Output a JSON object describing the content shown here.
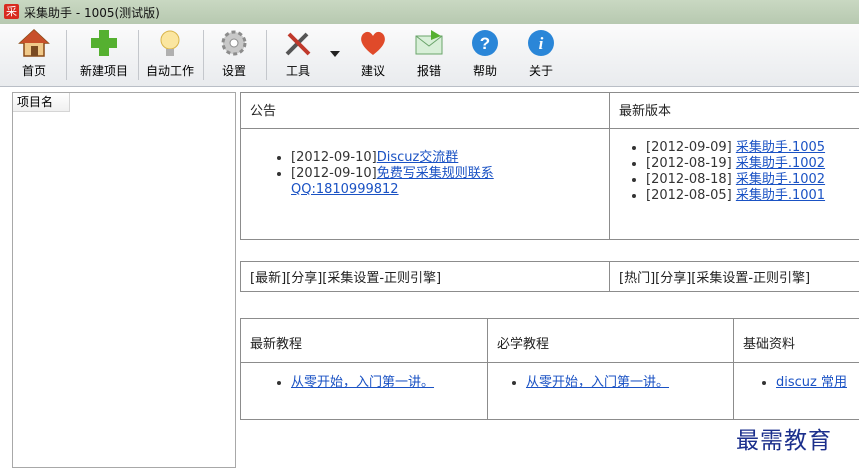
{
  "window": {
    "title": "采集助手 - 1005(测试版)",
    "app_icon_char": "采"
  },
  "toolbar": {
    "items": [
      {
        "label": "首页",
        "icon": "home-icon"
      },
      {
        "label": "新建项目",
        "icon": "plus-icon"
      },
      {
        "label": "自动工作",
        "icon": "bulb-icon"
      },
      {
        "label": "设置",
        "icon": "gear-icon"
      },
      {
        "label": "工具",
        "icon": "tools-icon"
      },
      {
        "label": "建议",
        "icon": "heart-icon"
      },
      {
        "label": "报错",
        "icon": "mail-icon"
      },
      {
        "label": "帮助",
        "icon": "help-icon"
      },
      {
        "label": "关于",
        "icon": "info-icon"
      }
    ]
  },
  "left_panel": {
    "column_header": "项目名"
  },
  "notice": {
    "header": "公告",
    "items": [
      {
        "date": "[2012-09-10]",
        "link": "Discuz交流群"
      },
      {
        "date": "[2012-09-10]",
        "link": "免费写采集规则联系QQ:1810999812"
      }
    ]
  },
  "latest_version": {
    "header": "最新版本",
    "items": [
      {
        "date": "[2012-09-09]",
        "link": "采集助手.1005"
      },
      {
        "date": "[2012-08-19]",
        "link": "采集助手.1002"
      },
      {
        "date": "[2012-08-18]",
        "link": "采集助手.1002"
      },
      {
        "date": "[2012-08-05]",
        "link": "采集助手.1001"
      }
    ]
  },
  "tag_bars": {
    "left": "[最新][分享][采集设置-正则引擎]",
    "right": "[热门][分享][采集设置-正则引擎]"
  },
  "tutorials": {
    "columns": [
      {
        "header": "最新教程",
        "link": "从零开始，入门第一讲。"
      },
      {
        "header": "必学教程",
        "link": "从零开始，入门第一讲。"
      },
      {
        "header": "基础资料",
        "link": "discuz 常用"
      }
    ]
  },
  "watermark": "最需教育",
  "colors": {
    "accent_link": "#1a52c4",
    "titlebar": "#c9d8c2",
    "brand_red": "#d82b1f"
  }
}
